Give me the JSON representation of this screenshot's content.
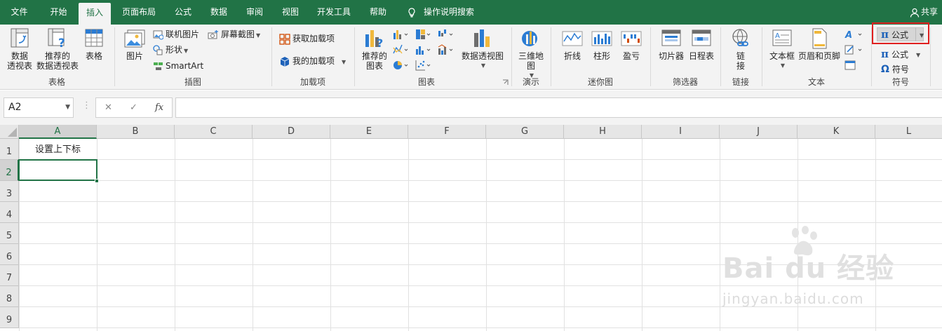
{
  "menubar": {
    "tabs": [
      {
        "label": "文件"
      },
      {
        "label": "开始"
      },
      {
        "label": "插入"
      },
      {
        "label": "页面布局"
      },
      {
        "label": "公式"
      },
      {
        "label": "数据"
      },
      {
        "label": "审阅"
      },
      {
        "label": "视图"
      },
      {
        "label": "开发工具"
      },
      {
        "label": "帮助"
      }
    ],
    "active_tab": "插入",
    "tell_me": "操作说明搜索",
    "share": "共享"
  },
  "ribbon": {
    "groups": {
      "tables": {
        "label": "表格",
        "pivot_table": {
          "line1": "数据",
          "line2": "透视表"
        },
        "recommended_pivot": {
          "line1": "推荐的",
          "line2": "数据透视表"
        },
        "table": "表格"
      },
      "illustrations": {
        "label": "插图",
        "pictures": "图片",
        "online_pictures": "联机图片",
        "shapes": "形状",
        "smartart": "SmartArt",
        "screenshot": "屏幕截图"
      },
      "addins": {
        "label": "加载项",
        "get_addins": "获取加载项",
        "my_addins": "我的加载项"
      },
      "charts": {
        "label": "图表",
        "recommended": {
          "line1": "推荐的",
          "line2": "图表"
        },
        "pivot_chart": "数据透视图"
      },
      "tours": {
        "label": "演示",
        "map3d": {
          "line1": "三维地",
          "line2": "图"
        }
      },
      "sparklines": {
        "label": "迷你图",
        "line": "折线",
        "column": "柱形",
        "winloss": "盈亏"
      },
      "filters": {
        "label": "筛选器",
        "slicer": "切片器",
        "timeline": "日程表"
      },
      "links": {
        "label": "链接",
        "link": {
          "line1": "链",
          "line2": "接"
        }
      },
      "text": {
        "label": "文本",
        "textbox": "文本框",
        "header_footer": "页眉和页脚"
      },
      "symbols": {
        "label": "符号",
        "equation": "公式",
        "symbol": "符号"
      }
    }
  },
  "formula_bar": {
    "name_box": "A2",
    "fx": "fx",
    "value": ""
  },
  "sheet": {
    "columns": [
      "A",
      "B",
      "C",
      "D",
      "E",
      "F",
      "G",
      "H",
      "I",
      "J",
      "K",
      "L"
    ],
    "rows": [
      "1",
      "2",
      "3",
      "4",
      "5",
      "6",
      "7",
      "8",
      "9"
    ],
    "cells": {
      "A1": "设置上下标"
    },
    "selected_cell": "A2"
  },
  "watermark": {
    "brand": "Bai du 经验",
    "url": "jingyan.baidu.com"
  },
  "colors": {
    "accent": "#217346",
    "highlight_box": "#e02020"
  }
}
